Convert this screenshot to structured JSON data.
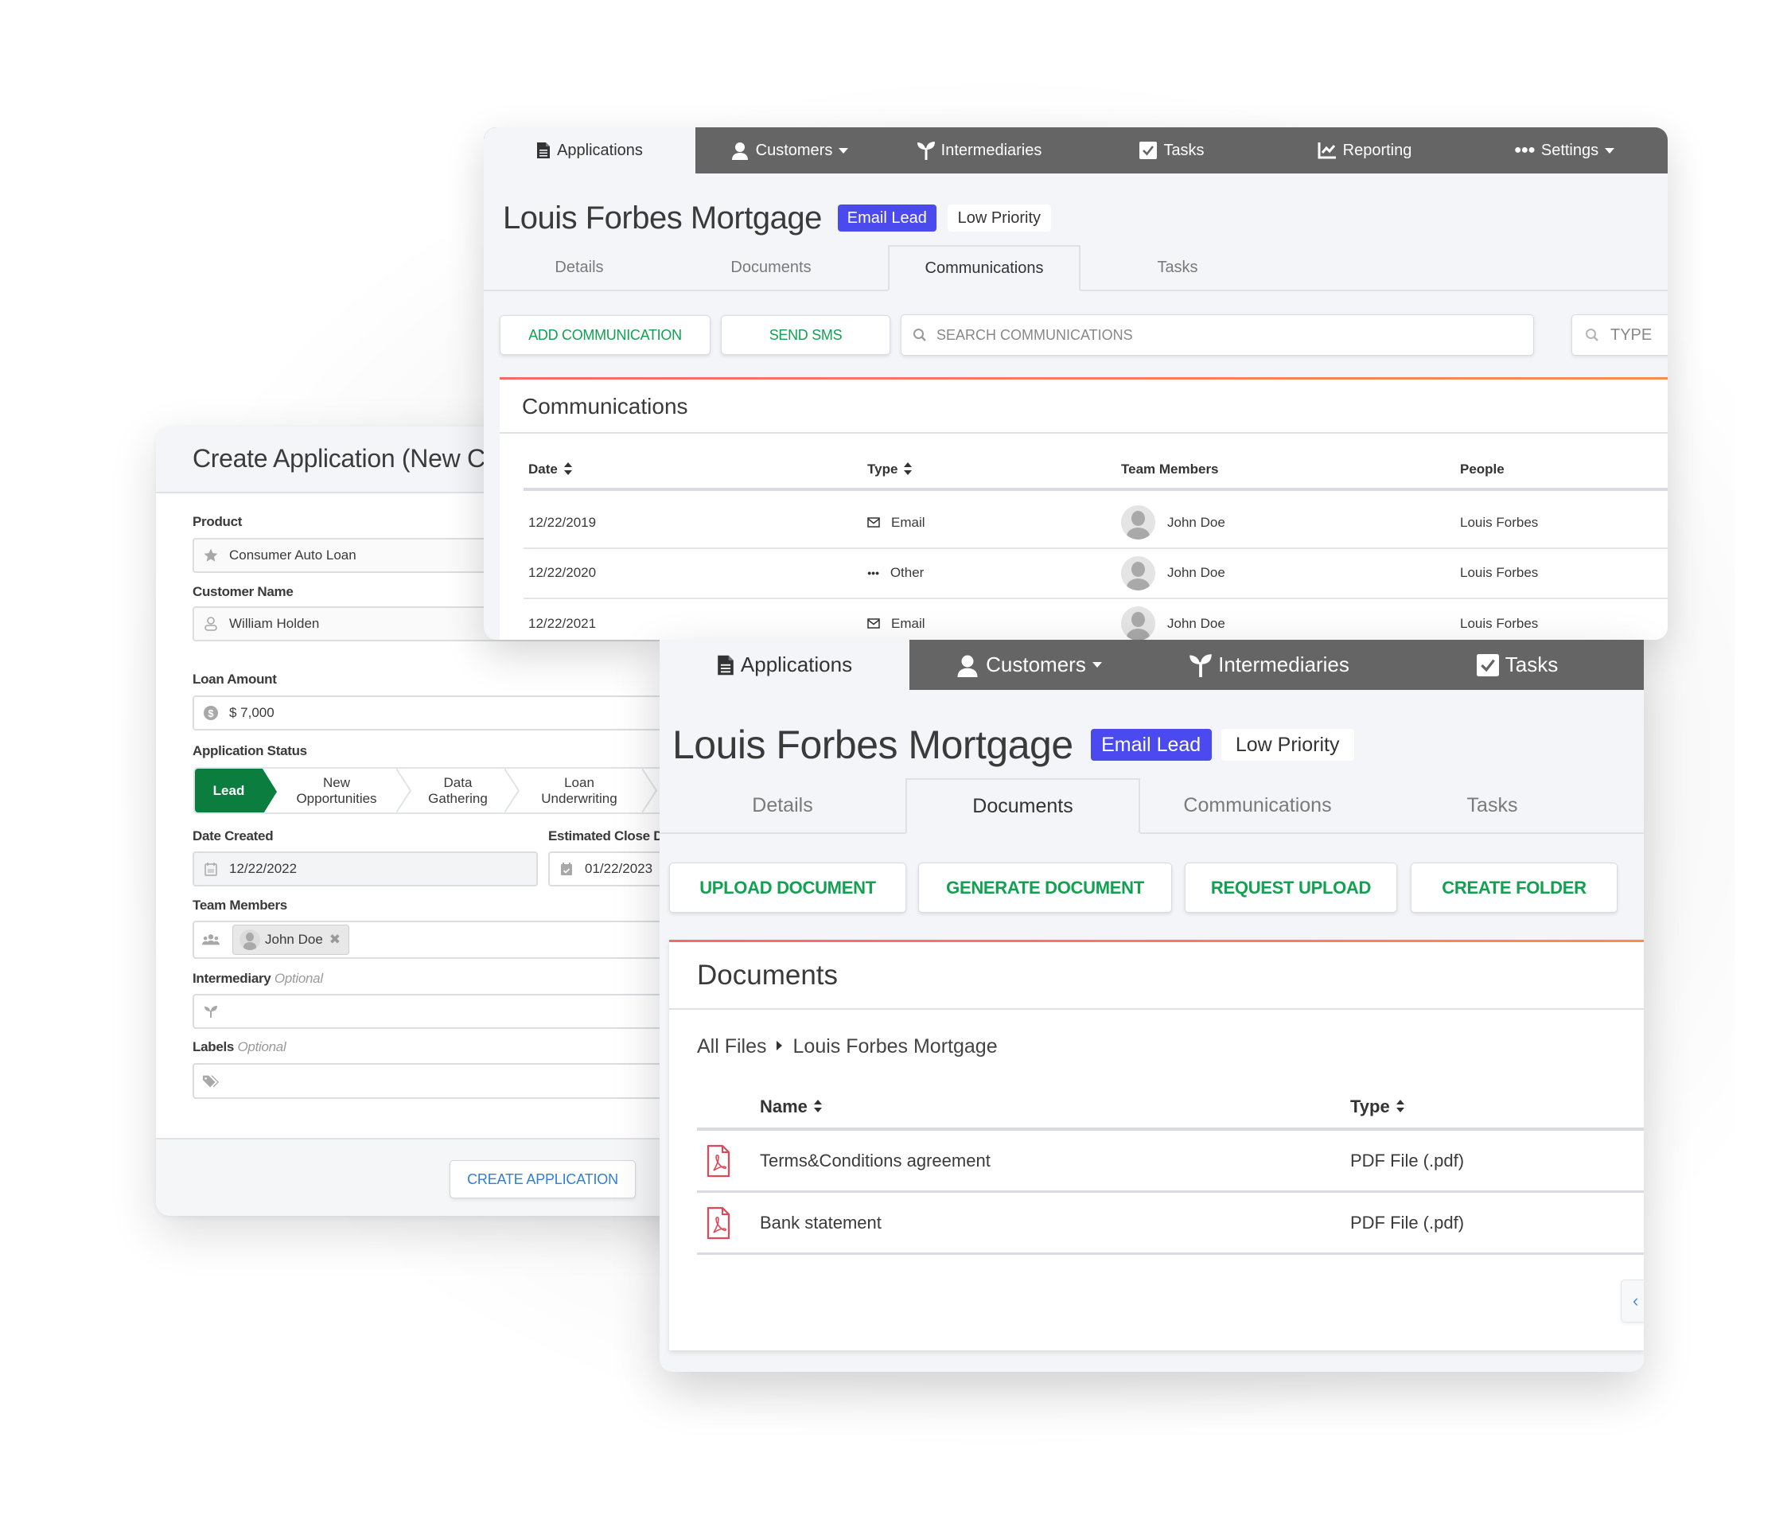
{
  "create_application": {
    "title": "Create Application (New C",
    "fields": {
      "product": {
        "label": "Product",
        "value": "Consumer Auto Loan",
        "icon": "star-icon"
      },
      "customer_name": {
        "label": "Customer Name",
        "value": "William Holden",
        "icon": "user-icon"
      },
      "loan_amount": {
        "label": "Loan Amount",
        "value": "$ 7,000",
        "icon": "dollar-circle-icon"
      },
      "application_status": {
        "label": "Application Status",
        "steps": [
          {
            "label": "Lead",
            "active": true
          },
          {
            "label_line1": "New",
            "label_line2": "Opportunities",
            "active": false
          },
          {
            "label_line1": "Data",
            "label_line2": "Gathering",
            "active": false
          },
          {
            "label_line1": "Loan",
            "label_line2": "Underwriting",
            "active": false
          }
        ]
      },
      "date_created": {
        "label": "Date Created",
        "value": "12/22/2022",
        "icon": "calendar-icon"
      },
      "estimated_close_date": {
        "label": "Estimated Close D",
        "value": "01/22/2023",
        "icon": "calendar-check-icon"
      },
      "team_members": {
        "label": "Team Members",
        "chips": [
          "John Doe"
        ],
        "icon": "users-icon"
      },
      "intermediary": {
        "label": "Intermediary",
        "optional": "Optional",
        "value": "",
        "icon": "seedling-icon"
      },
      "labels": {
        "label": "Labels",
        "optional": "Optional",
        "value": "",
        "icon": "tags-icon"
      }
    },
    "create_button": "CREATE APPLICATION"
  },
  "communications_window": {
    "nav": [
      {
        "label": "Applications",
        "icon": "file-icon",
        "active": true
      },
      {
        "label": "Customers",
        "icon": "user-icon",
        "dropdown": true
      },
      {
        "label": "Intermediaries",
        "icon": "seedling-icon"
      },
      {
        "label": "Tasks",
        "icon": "checkbox-icon"
      },
      {
        "label": "Reporting",
        "icon": "chart-line-icon"
      },
      {
        "label": "Settings",
        "icon": "ellipsis-icon",
        "dropdown": true
      }
    ],
    "title": "Louis Forbes Mortgage",
    "badges": {
      "lead": "Email Lead",
      "priority": "Low Priority"
    },
    "tabs": [
      "Details",
      "Documents",
      "Communications",
      "Tasks"
    ],
    "active_tab": "Communications",
    "buttons": {
      "add": "ADD COMMUNICATION",
      "sms": "SEND SMS"
    },
    "search_placeholder": "SEARCH COMMUNICATIONS",
    "type_placeholder": "TYPE",
    "card_title": "Communications",
    "table": {
      "columns": [
        "Date",
        "Type",
        "Team Members",
        "People"
      ],
      "rows": [
        {
          "date": "12/22/2019",
          "type": "Email",
          "type_icon": "envelope-icon",
          "member": "John Doe",
          "people": "Louis Forbes"
        },
        {
          "date": "12/22/2020",
          "type": "Other",
          "type_icon": "ellipsis-icon",
          "member": "John Doe",
          "people": "Louis Forbes"
        },
        {
          "date": "12/22/2021",
          "type": "Email",
          "type_icon": "envelope-icon",
          "member": "John Doe",
          "people": "Louis Forbes"
        }
      ]
    }
  },
  "documents_window": {
    "nav": [
      {
        "label": "Applications",
        "icon": "file-icon",
        "active": true
      },
      {
        "label": "Customers",
        "icon": "user-icon",
        "dropdown": true
      },
      {
        "label": "Intermediaries",
        "icon": "seedling-icon"
      },
      {
        "label": "Tasks",
        "icon": "checkbox-icon"
      }
    ],
    "title": "Louis Forbes Mortgage",
    "badges": {
      "lead": "Email Lead",
      "priority": "Low Priority"
    },
    "tabs": [
      "Details",
      "Documents",
      "Communications",
      "Tasks"
    ],
    "active_tab": "Documents",
    "buttons": [
      "UPLOAD DOCUMENT",
      "GENERATE DOCUMENT",
      "REQUEST UPLOAD",
      "CREATE FOLDER"
    ],
    "card_title": "Documents",
    "breadcrumb": [
      "All Files",
      "Louis Forbes Mortgage"
    ],
    "table": {
      "columns": [
        "Name",
        "Type"
      ],
      "rows": [
        {
          "name": "Terms&Conditions agreement",
          "type": "PDF File (.pdf)",
          "icon": "pdf-file-icon"
        },
        {
          "name": "Bank statement",
          "type": "PDF File (.pdf)",
          "icon": "pdf-file-icon"
        }
      ]
    },
    "pagination_prev_icon": "chevron-left-icon"
  },
  "colors": {
    "nav_bg": "#656565",
    "badge_blue": "#4a4aef",
    "action_green": "#12a150",
    "status_green": "#0b7d3e",
    "link_blue": "#2f7fd6",
    "accent_red": "#f26d6d",
    "pdf_red": "#e0485a"
  }
}
